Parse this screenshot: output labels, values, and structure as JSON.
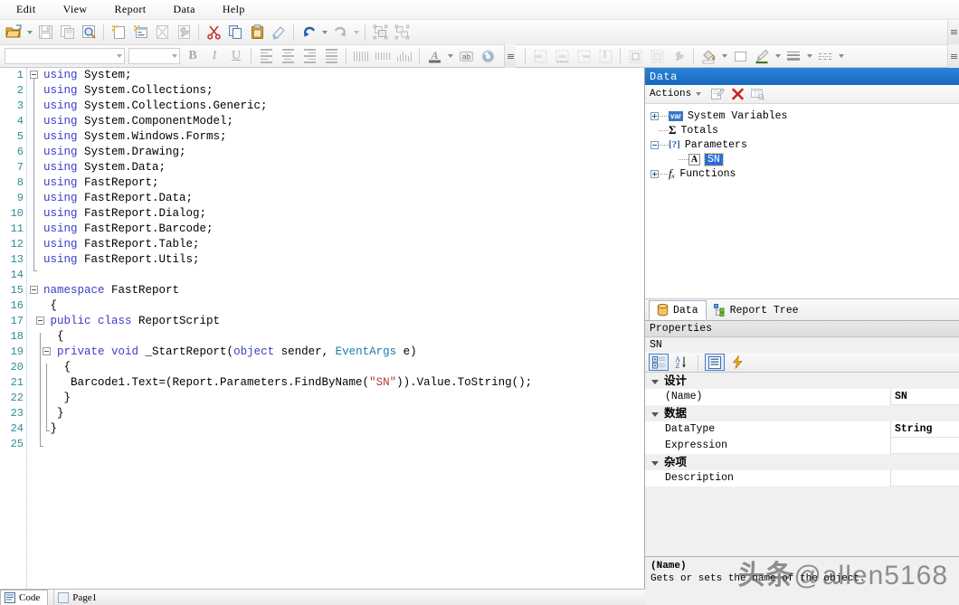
{
  "menu": {
    "items": [
      "Edit",
      "View",
      "Report",
      "Data",
      "Help"
    ]
  },
  "toolbar_main": {
    "buttons": [
      {
        "name": "open-file-button",
        "icon": "open-folder-icon"
      },
      {
        "name": "open-dropdown-button",
        "icon": "chevron-down-icon"
      },
      {
        "name": "save-button",
        "icon": "floppy-disk-icon"
      },
      {
        "name": "save-all-button",
        "icon": "copy-pages-icon"
      },
      {
        "name": "preview-button",
        "icon": "magnifier-icon"
      },
      {
        "name": "new-page-button",
        "icon": "new-page-icon"
      },
      {
        "name": "new-dialog-button",
        "icon": "new-dialog-icon"
      },
      {
        "name": "delete-page-button",
        "icon": "delete-page-icon"
      },
      {
        "name": "page-settings-button",
        "icon": "wrench-icon"
      },
      {
        "name": "cut-button",
        "icon": "scissors-icon"
      },
      {
        "name": "copy-button",
        "icon": "copy-icon"
      },
      {
        "name": "paste-button",
        "icon": "clipboard-icon"
      },
      {
        "name": "format-painter-button",
        "icon": "brush-icon"
      },
      {
        "name": "undo-button",
        "icon": "undo-arrow-icon"
      },
      {
        "name": "undo-dropdown-button",
        "icon": "chevron-down-icon"
      },
      {
        "name": "redo-button",
        "icon": "redo-arrow-icon"
      },
      {
        "name": "redo-dropdown-button",
        "icon": "chevron-down-icon"
      },
      {
        "name": "group-button",
        "icon": "group-objects-icon"
      },
      {
        "name": "ungroup-button",
        "icon": "ungroup-objects-icon"
      },
      {
        "name": "toolbar-overflow-button",
        "icon": "overflow-chevron-icon"
      }
    ]
  },
  "toolbar_format": {
    "font_name": "",
    "font_size": "",
    "buttons": [
      {
        "name": "bold-button",
        "label": "B"
      },
      {
        "name": "italic-button",
        "label": "I"
      },
      {
        "name": "underline-button",
        "label": "U"
      },
      {
        "name": "align-left-button",
        "icon": "align-left-icon"
      },
      {
        "name": "align-center-button",
        "icon": "align-center-icon"
      },
      {
        "name": "align-right-button",
        "icon": "align-right-icon"
      },
      {
        "name": "align-justify-button",
        "icon": "align-justify-icon"
      },
      {
        "name": "align-top-button",
        "icon": "align-top-icon"
      },
      {
        "name": "align-middle-button",
        "icon": "align-middle-icon"
      },
      {
        "name": "align-bottom-button",
        "icon": "align-bottom-icon"
      },
      {
        "name": "text-color-button",
        "icon": "font-color-icon"
      },
      {
        "name": "text-color-dropdown",
        "icon": "chevron-down-icon"
      },
      {
        "name": "word-wrap-button",
        "icon": "ab-wrap-icon"
      },
      {
        "name": "rotate-text-button",
        "icon": "rotate-icon"
      },
      {
        "name": "format-overflow-button",
        "icon": "overflow-chevron-icon"
      }
    ]
  },
  "toolbar_layout": {
    "buttons": [
      {
        "name": "align-grid-left-button",
        "icon": "grid-align-left-icon"
      },
      {
        "name": "align-grid-center-button",
        "icon": "grid-align-center-icon"
      },
      {
        "name": "align-grid-right-button",
        "icon": "grid-align-right-icon"
      },
      {
        "name": "align-grid-top-button",
        "icon": "grid-align-top-icon"
      },
      {
        "name": "same-size-button",
        "icon": "same-size-icon"
      },
      {
        "name": "size-to-grid-button",
        "icon": "size-to-grid-icon"
      },
      {
        "name": "layout-settings-button",
        "icon": "wrench-icon"
      },
      {
        "name": "fill-color-button",
        "icon": "paint-bucket-icon"
      },
      {
        "name": "fill-color-dropdown",
        "icon": "chevron-down-icon"
      },
      {
        "name": "fill-none-button",
        "icon": "white-square-icon"
      },
      {
        "name": "border-color-button",
        "icon": "marker-pen-icon"
      },
      {
        "name": "border-color-dropdown",
        "icon": "chevron-down-icon"
      },
      {
        "name": "border-width-button",
        "icon": "line-weight-icon"
      },
      {
        "name": "border-width-dropdown",
        "icon": "chevron-down-icon"
      },
      {
        "name": "border-style-button",
        "icon": "line-style-icon"
      },
      {
        "name": "border-style-dropdown",
        "icon": "chevron-down-icon"
      },
      {
        "name": "layout-overflow-button",
        "icon": "overflow-chevron-icon"
      }
    ]
  },
  "editor": {
    "lines": [
      {
        "num": "1",
        "indent": 0,
        "segs": [
          {
            "t": "using ",
            "c": "kw"
          },
          {
            "t": "System;",
            "c": "pn"
          }
        ]
      },
      {
        "num": "2",
        "indent": 0,
        "segs": [
          {
            "t": "using ",
            "c": "kw"
          },
          {
            "t": "System.Collections;",
            "c": "pn"
          }
        ]
      },
      {
        "num": "3",
        "indent": 0,
        "segs": [
          {
            "t": "using ",
            "c": "kw"
          },
          {
            "t": "System.Collections.Generic;",
            "c": "pn"
          }
        ]
      },
      {
        "num": "4",
        "indent": 0,
        "segs": [
          {
            "t": "using ",
            "c": "kw"
          },
          {
            "t": "System.ComponentModel;",
            "c": "pn"
          }
        ]
      },
      {
        "num": "5",
        "indent": 0,
        "segs": [
          {
            "t": "using ",
            "c": "kw"
          },
          {
            "t": "System.Windows.Forms;",
            "c": "pn"
          }
        ]
      },
      {
        "num": "6",
        "indent": 0,
        "segs": [
          {
            "t": "using ",
            "c": "kw"
          },
          {
            "t": "System.Drawing;",
            "c": "pn"
          }
        ]
      },
      {
        "num": "7",
        "indent": 0,
        "segs": [
          {
            "t": "using ",
            "c": "kw"
          },
          {
            "t": "System.Data;",
            "c": "pn"
          }
        ]
      },
      {
        "num": "8",
        "indent": 0,
        "segs": [
          {
            "t": "using ",
            "c": "kw"
          },
          {
            "t": "FastReport;",
            "c": "pn"
          }
        ]
      },
      {
        "num": "9",
        "indent": 0,
        "segs": [
          {
            "t": "using ",
            "c": "kw"
          },
          {
            "t": "FastReport.Data;",
            "c": "pn"
          }
        ]
      },
      {
        "num": "10",
        "indent": 0,
        "segs": [
          {
            "t": "using ",
            "c": "kw"
          },
          {
            "t": "FastReport.Dialog;",
            "c": "pn"
          }
        ]
      },
      {
        "num": "11",
        "indent": 0,
        "segs": [
          {
            "t": "using ",
            "c": "kw"
          },
          {
            "t": "FastReport.Barcode;",
            "c": "pn"
          }
        ]
      },
      {
        "num": "12",
        "indent": 0,
        "segs": [
          {
            "t": "using ",
            "c": "kw"
          },
          {
            "t": "FastReport.Table;",
            "c": "pn"
          }
        ]
      },
      {
        "num": "13",
        "indent": 0,
        "segs": [
          {
            "t": "using ",
            "c": "kw"
          },
          {
            "t": "FastReport.Utils;",
            "c": "pn"
          }
        ]
      },
      {
        "num": "14",
        "indent": 0,
        "segs": []
      },
      {
        "num": "15",
        "indent": 0,
        "segs": [
          {
            "t": "namespace ",
            "c": "kw"
          },
          {
            "t": "FastReport",
            "c": "pn"
          }
        ]
      },
      {
        "num": "16",
        "indent": 1,
        "segs": [
          {
            "t": "{",
            "c": "pn"
          }
        ]
      },
      {
        "num": "17",
        "indent": 1,
        "segs": [
          {
            "t": "public class ",
            "c": "kw"
          },
          {
            "t": "ReportScript",
            "c": "pn"
          }
        ]
      },
      {
        "num": "18",
        "indent": 2,
        "segs": [
          {
            "t": "{",
            "c": "pn"
          }
        ]
      },
      {
        "num": "19",
        "indent": 2,
        "segs": [
          {
            "t": "private void ",
            "c": "kw"
          },
          {
            "t": "_StartReport(",
            "c": "pn"
          },
          {
            "t": "object",
            "c": "kw"
          },
          {
            "t": " sender, ",
            "c": "pn"
          },
          {
            "t": "EventArgs",
            "c": "ty"
          },
          {
            "t": " e)",
            "c": "pn"
          }
        ]
      },
      {
        "num": "20",
        "indent": 3,
        "segs": [
          {
            "t": "{",
            "c": "pn"
          }
        ]
      },
      {
        "num": "21",
        "indent": 4,
        "segs": [
          {
            "t": "Barcode1.Text=(Report.Parameters.FindByName(",
            "c": "pn"
          },
          {
            "t": "\"SN\"",
            "c": "st"
          },
          {
            "t": ")).Value.ToString();",
            "c": "pn"
          }
        ]
      },
      {
        "num": "22",
        "indent": 3,
        "segs": [
          {
            "t": "}",
            "c": "pn"
          }
        ]
      },
      {
        "num": "23",
        "indent": 2,
        "segs": [
          {
            "t": "}",
            "c": "pn"
          }
        ]
      },
      {
        "num": "24",
        "indent": 1,
        "segs": [
          {
            "t": "}",
            "c": "pn"
          }
        ]
      },
      {
        "num": "25",
        "indent": 0,
        "segs": []
      }
    ]
  },
  "bottom_tabs": {
    "code_label": "Code",
    "page_label": "Page1"
  },
  "data_panel": {
    "title": "Data",
    "actions_label": "Actions",
    "toolbar": [
      {
        "name": "edit-datasource-button",
        "icon": "edit-note-icon"
      },
      {
        "name": "delete-datasource-button",
        "icon": "red-x-icon"
      },
      {
        "name": "view-data-button",
        "icon": "table-view-icon"
      }
    ],
    "tree": [
      {
        "label": "System Variables",
        "icon": "var-badge-icon",
        "expander": "plus",
        "depth": 0
      },
      {
        "label": "Totals",
        "icon": "sigma-icon",
        "expander": "none",
        "depth": 0
      },
      {
        "label": "Parameters",
        "icon": "parameter-icon",
        "expander": "minus",
        "depth": 0
      },
      {
        "label": "SN",
        "icon": "string-a-icon",
        "expander": "none",
        "depth": 1,
        "selected": true
      },
      {
        "label": "Functions",
        "icon": "fx-icon",
        "expander": "plus",
        "depth": 0
      }
    ]
  },
  "dock_tabs": [
    {
      "label": "Data",
      "icon": "database-icon",
      "active": true
    },
    {
      "label": "Report Tree",
      "icon": "tree-icon",
      "active": false
    }
  ],
  "properties_panel": {
    "title": "Properties",
    "object_name": "SN",
    "toolbar": [
      {
        "name": "categorized-view-button",
        "icon": "categorized-icon",
        "active": true
      },
      {
        "name": "alphabetical-view-button",
        "icon": "sort-az-icon",
        "active": false
      },
      {
        "name": "property-pages-button",
        "icon": "property-pages-icon",
        "active": true
      },
      {
        "name": "events-button",
        "icon": "lightning-bolt-icon",
        "active": false
      }
    ],
    "rows": [
      {
        "kind": "category",
        "name": "设计",
        "value": ""
      },
      {
        "kind": "prop",
        "name": "(Name)",
        "value": "SN"
      },
      {
        "kind": "category",
        "name": "数据",
        "value": ""
      },
      {
        "kind": "prop",
        "name": "DataType",
        "value": "String"
      },
      {
        "kind": "prop",
        "name": "Expression",
        "value": ""
      },
      {
        "kind": "category",
        "name": "杂项",
        "value": ""
      },
      {
        "kind": "prop",
        "name": "Description",
        "value": ""
      }
    ],
    "description": {
      "title": "(Name)",
      "text": "Gets or sets the name of the object."
    }
  },
  "watermark": {
    "cn": "头条",
    "handle": "@allen5168"
  },
  "colors": {
    "panel_title_blue": "#1868bd",
    "selection_blue": "#2a6fd8",
    "keyword_blue": "#3b3bc8",
    "string_red": "#b03a3a",
    "line_number_teal": "#2e8b95",
    "chrome_gray": "#f0f0f0"
  }
}
